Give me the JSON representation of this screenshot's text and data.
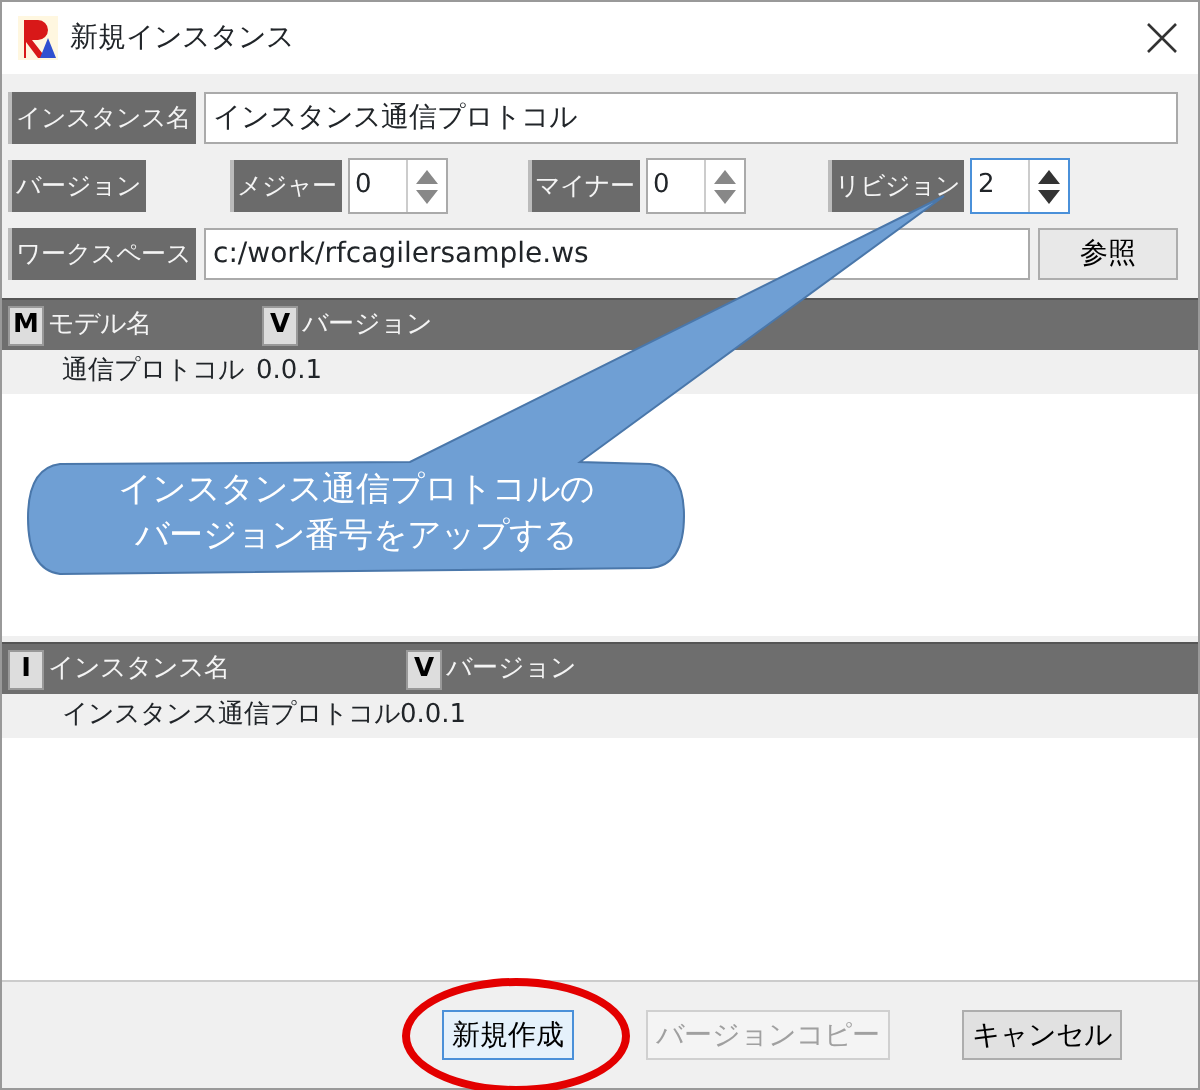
{
  "window": {
    "title": "新規インスタンス"
  },
  "instance_name": {
    "label": "インスタンス名",
    "value": "インスタンス通信プロトコル"
  },
  "version": {
    "label": "バージョン",
    "spinners": [
      {
        "label": "メジャー",
        "value": "0",
        "focused": false
      },
      {
        "label": "マイナー",
        "value": "0",
        "focused": false
      },
      {
        "label": "リビジョン",
        "value": "2",
        "focused": true
      }
    ]
  },
  "workspace": {
    "label": "ワークスペース",
    "value": "c:/work/rfcagilersample.ws",
    "button": "参照"
  },
  "models_table": {
    "columns": [
      {
        "icon": "M",
        "label": "モデル名"
      },
      {
        "icon": "V",
        "label": "バージョン"
      }
    ],
    "rows": [
      {
        "name": "通信プロトコル",
        "version": "0.0.1"
      }
    ]
  },
  "instances_table": {
    "columns": [
      {
        "icon": "I",
        "label": "インスタンス名"
      },
      {
        "icon": "V",
        "label": "バージョン"
      }
    ],
    "rows": [
      {
        "name": "インスタンス通信プロトコル",
        "version": "0.0.1"
      }
    ]
  },
  "buttons": [
    {
      "label": "新規作成",
      "disabled": false,
      "circled": true
    },
    {
      "label": "バージョンコピー",
      "disabled": true,
      "circled": false
    },
    {
      "label": "キャンセル",
      "disabled": false,
      "circled": false
    }
  ],
  "callout": {
    "lines": [
      "インスタンス通信プロトコルの",
      "バージョン番号をアップする"
    ]
  }
}
